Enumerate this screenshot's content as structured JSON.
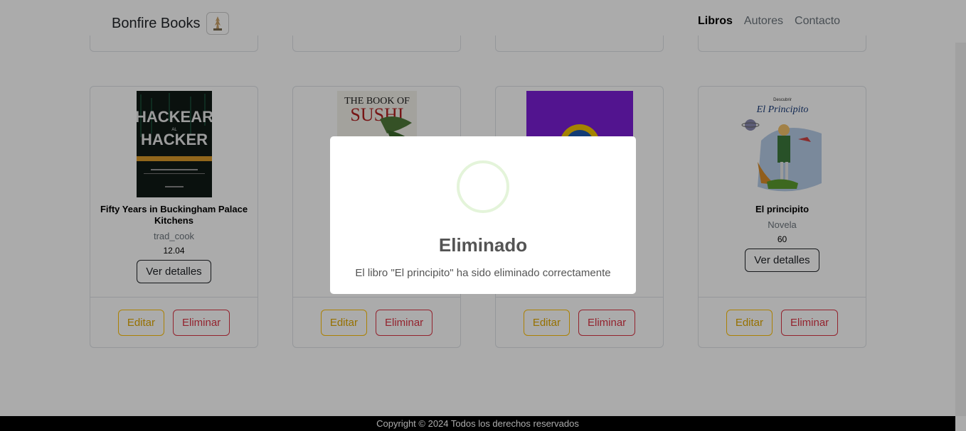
{
  "navbar": {
    "brand": "Bonfire Books",
    "links": [
      {
        "label": "Libros",
        "active": true
      },
      {
        "label": "Autores",
        "active": false
      },
      {
        "label": "Contacto",
        "active": false
      }
    ]
  },
  "books": [
    {
      "title": "Fifty Years in Buckingham Palace Kitchens",
      "genre": "trad_cook",
      "price": "12.04",
      "cover_text": [
        "HACKEAR",
        "AL",
        "HACKER"
      ]
    },
    {
      "title": "",
      "genre": "",
      "price": "",
      "cover_text": [
        "THE BOOK OF",
        "SUSHI"
      ]
    },
    {
      "title": "",
      "genre": "",
      "price": "",
      "cover_text": []
    },
    {
      "title": "El principito",
      "genre": "Novela",
      "price": "60",
      "cover_text": [
        "Descubrir",
        "El Principito"
      ]
    }
  ],
  "buttons": {
    "details": "Ver detalles",
    "edit": "Editar",
    "delete": "Eliminar"
  },
  "footer": {
    "text": "Copyright © 2024 Todos los derechos reservados"
  },
  "modal": {
    "title": "Eliminado",
    "message": "El libro \"El principito\" ha sido eliminado correctamente",
    "icon": "success-icon"
  },
  "colors": {
    "edit": "#ffc107",
    "delete": "#dc3545",
    "overlay": "rgba(0,0,0,0.33)"
  }
}
